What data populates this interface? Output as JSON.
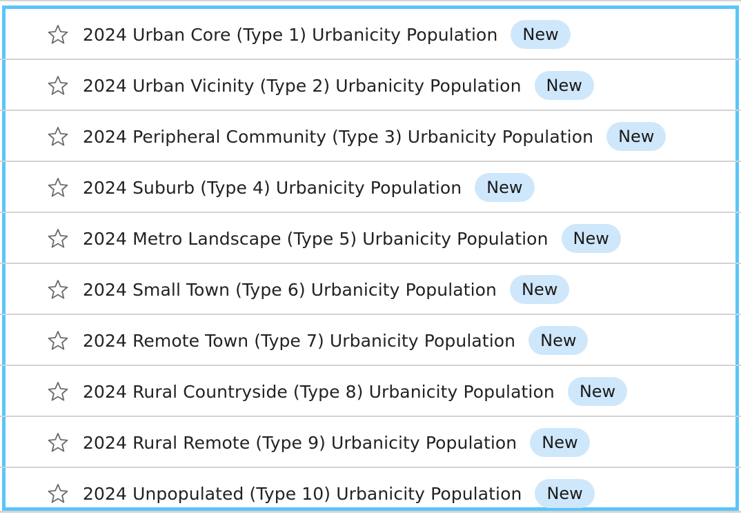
{
  "list": {
    "items": [
      {
        "title": "2024 Urban Core (Type 1) Urbanicity Population",
        "badge": "New",
        "icon": "star-outline-icon"
      },
      {
        "title": "2024 Urban Vicinity (Type 2) Urbanicity Population",
        "badge": "New",
        "icon": "star-outline-icon"
      },
      {
        "title": "2024 Peripheral Community (Type 3) Urbanicity Population",
        "badge": "New",
        "icon": "star-outline-icon"
      },
      {
        "title": "2024 Suburb (Type 4) Urbanicity Population",
        "badge": "New",
        "icon": "star-outline-icon"
      },
      {
        "title": "2024 Metro Landscape (Type 5) Urbanicity Population",
        "badge": "New",
        "icon": "star-outline-icon"
      },
      {
        "title": "2024 Small Town (Type 6) Urbanicity Population",
        "badge": "New",
        "icon": "star-outline-icon"
      },
      {
        "title": "2024 Remote Town (Type 7) Urbanicity Population",
        "badge": "New",
        "icon": "star-outline-icon"
      },
      {
        "title": "2024 Rural Countryside (Type 8) Urbanicity Population",
        "badge": "New",
        "icon": "star-outline-icon"
      },
      {
        "title": "2024 Rural Remote (Type 9) Urbanicity Population",
        "badge": "New",
        "icon": "star-outline-icon"
      },
      {
        "title": "2024 Unpopulated (Type 10) Urbanicity Population",
        "badge": "New",
        "icon": "star-outline-icon"
      }
    ]
  },
  "colors": {
    "focus_border": "#5bc5f7",
    "badge_bg": "#cfe7fb",
    "separator": "#d2d2d2",
    "text": "#222222",
    "star_stroke": "#6b6b6b"
  }
}
